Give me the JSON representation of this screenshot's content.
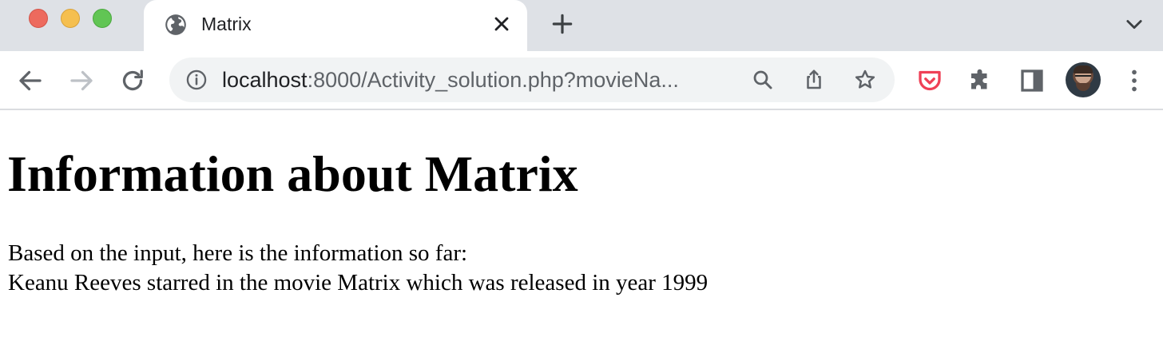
{
  "browser": {
    "tab": {
      "title": "Matrix"
    },
    "omnibox": {
      "url_host": "localhost",
      "url_rest": ":8000/Activity_solution.php?movieNa..."
    },
    "colors": {
      "tabstrip": "#dee1e6",
      "omnibox": "#f1f3f4",
      "pocket": "#ef4056",
      "icon": "#5f6368"
    },
    "icons": [
      "globe-icon",
      "close-icon",
      "plus-icon",
      "chevron-down-icon",
      "back-arrow-icon",
      "forward-arrow-icon",
      "reload-icon",
      "info-icon",
      "search-icon",
      "share-icon",
      "star-icon",
      "pocket-icon",
      "puzzle-icon",
      "side-panel-icon",
      "avatar",
      "kebab-menu-icon"
    ]
  },
  "page": {
    "heading": "Information about Matrix",
    "lines": [
      "Based on the input, here is the information so far:",
      "Keanu Reeves starred in the movie Matrix which was released in year 1999"
    ]
  }
}
